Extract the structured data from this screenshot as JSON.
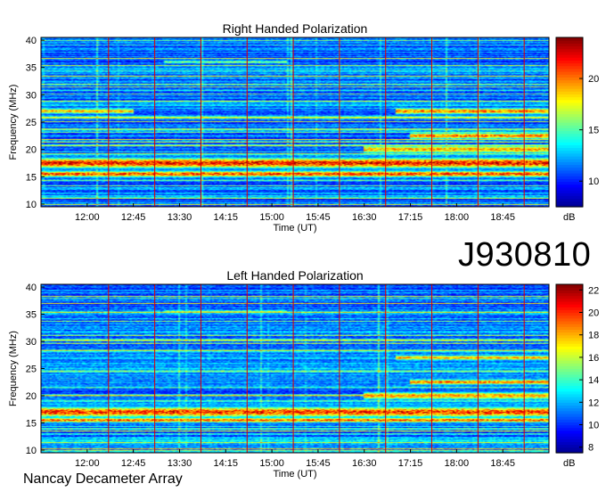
{
  "observation_id": "J930810",
  "observatory": "Nancay Decameter Array",
  "colormap": [
    "#00008f",
    "#0000ff",
    "#0080ff",
    "#00ffff",
    "#80ff80",
    "#ffff00",
    "#ff8000",
    "#ff0000",
    "#800000"
  ],
  "chart_data": [
    {
      "type": "heatmap",
      "title": "Right Handed Polarization",
      "xlabel": "Time (UT)",
      "ylabel": "Frequency (MHz)",
      "x_ticks": [
        "12:00",
        "12:45",
        "13:30",
        "14:15",
        "15:00",
        "15:45",
        "16:30",
        "17:15",
        "18:00",
        "18:45"
      ],
      "x_range": [
        "11:15",
        "19:30"
      ],
      "y_ticks": [
        10,
        15,
        20,
        25,
        30,
        35,
        40
      ],
      "ylim": [
        9.5,
        40.5
      ],
      "colorbar": {
        "label": "dB",
        "ticks": [
          10,
          15,
          20
        ],
        "range": [
          7.5,
          24
        ]
      },
      "emission_bands": [
        {
          "center_mhz": 17.5,
          "width_mhz": 2.0,
          "level_db": 23,
          "time_span": [
            "11:15",
            "19:30"
          ]
        },
        {
          "center_mhz": 15.5,
          "width_mhz": 1.2,
          "level_db": 22,
          "time_span": [
            "11:15",
            "19:30"
          ]
        },
        {
          "center_mhz": 20.0,
          "width_mhz": 1.5,
          "level_db": 20,
          "time_span": [
            "16:30",
            "19:30"
          ]
        },
        {
          "center_mhz": 22.5,
          "width_mhz": 1.2,
          "level_db": 21,
          "time_span": [
            "17:15",
            "19:30"
          ]
        },
        {
          "center_mhz": 27.0,
          "width_mhz": 1.0,
          "level_db": 20,
          "time_span": [
            "11:15",
            "12:45"
          ]
        },
        {
          "center_mhz": 27.0,
          "width_mhz": 1.2,
          "level_db": 21,
          "time_span": [
            "17:00",
            "19:30"
          ]
        },
        {
          "center_mhz": 36.0,
          "width_mhz": 0.6,
          "level_db": 17,
          "time_span": [
            "13:15",
            "15:15"
          ]
        }
      ]
    },
    {
      "type": "heatmap",
      "title": "Left Handed Polarization",
      "xlabel": "Time (UT)",
      "ylabel": "Frequency (MHz)",
      "x_ticks": [
        "12:00",
        "12:45",
        "13:30",
        "14:15",
        "15:00",
        "15:45",
        "16:30",
        "17:15",
        "18:00",
        "18:45"
      ],
      "x_range": [
        "11:15",
        "19:30"
      ],
      "y_ticks": [
        10,
        15,
        20,
        25,
        30,
        35,
        40
      ],
      "ylim": [
        9.5,
        40.5
      ],
      "colorbar": {
        "label": "dB",
        "ticks": [
          8,
          10,
          12,
          14,
          16,
          18,
          20,
          22
        ],
        "range": [
          7.5,
          22.5
        ]
      },
      "emission_bands": [
        {
          "center_mhz": 17.0,
          "width_mhz": 2.0,
          "level_db": 21,
          "time_span": [
            "11:15",
            "19:30"
          ]
        },
        {
          "center_mhz": 15.5,
          "width_mhz": 1.0,
          "level_db": 20,
          "time_span": [
            "11:15",
            "19:30"
          ]
        },
        {
          "center_mhz": 20.0,
          "width_mhz": 1.5,
          "level_db": 19,
          "time_span": [
            "16:30",
            "19:30"
          ]
        },
        {
          "center_mhz": 22.5,
          "width_mhz": 1.0,
          "level_db": 20,
          "time_span": [
            "17:15",
            "19:30"
          ]
        },
        {
          "center_mhz": 27.0,
          "width_mhz": 1.0,
          "level_db": 19,
          "time_span": [
            "17:00",
            "19:30"
          ]
        },
        {
          "center_mhz": 35.5,
          "width_mhz": 0.6,
          "level_db": 16,
          "time_span": [
            "13:15",
            "15:15"
          ]
        }
      ]
    }
  ]
}
